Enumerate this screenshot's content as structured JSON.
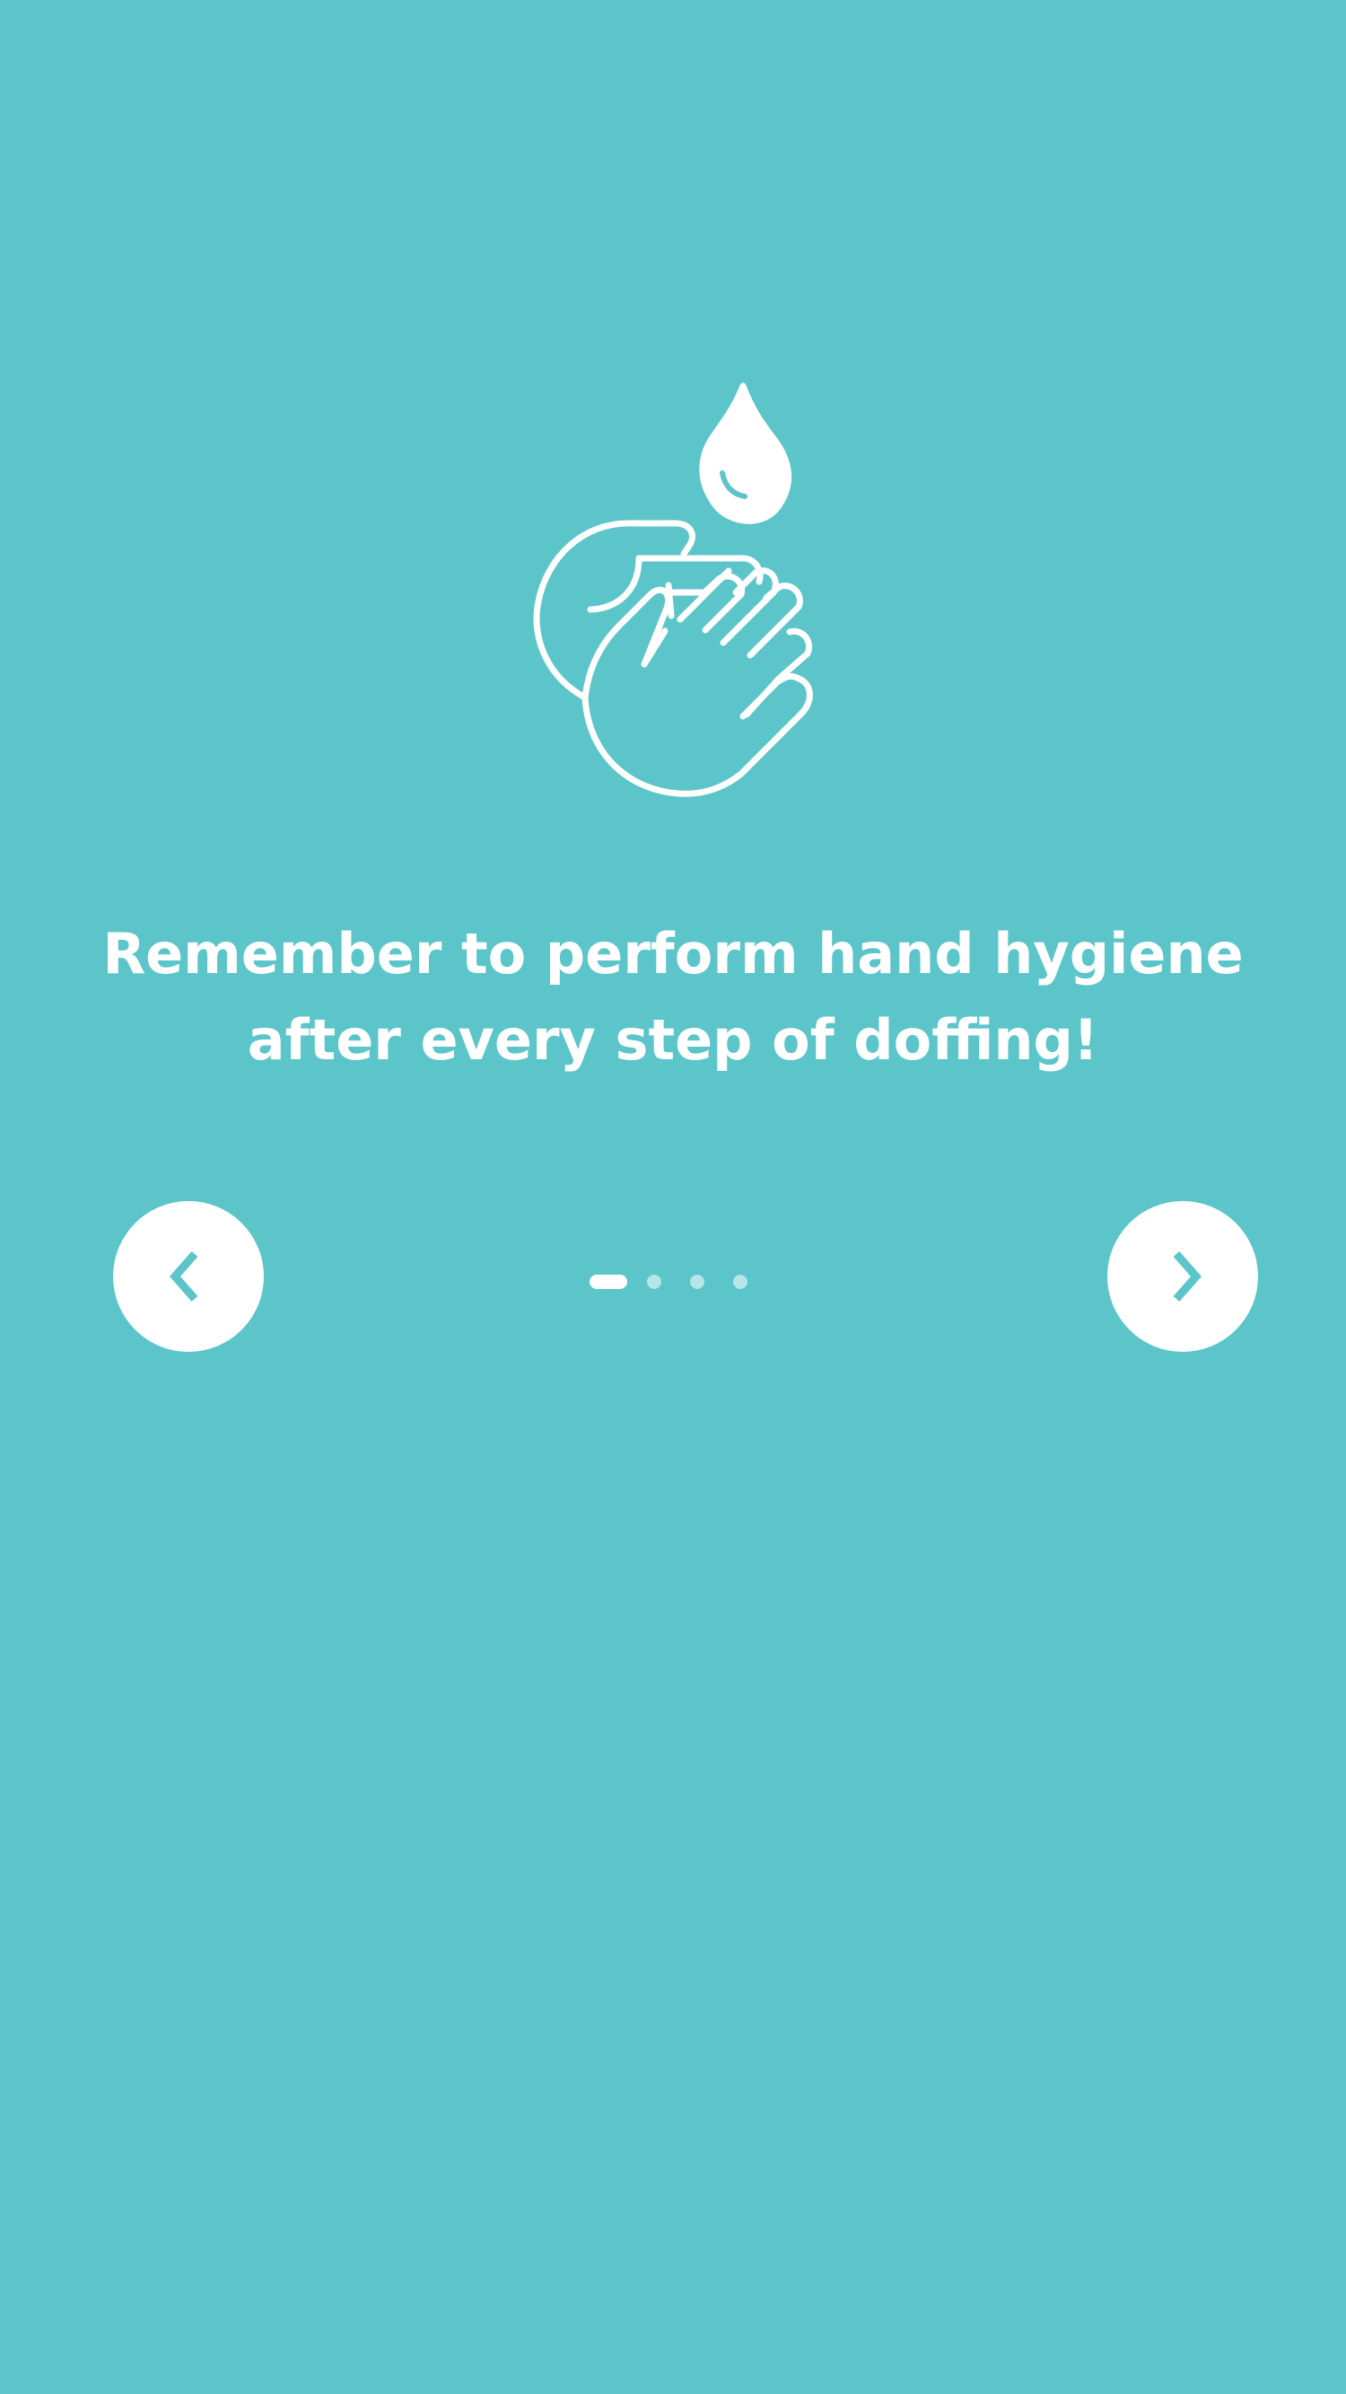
{
  "colors": {
    "background": "#5BC5CA",
    "foreground": "#FFFFFF",
    "accent": "#5BC5CA"
  },
  "message": {
    "line1": "Remember to perform hand hygiene",
    "line2": "after every step of doffing!"
  },
  "icons": {
    "hero": "hand-washing-icon",
    "prev": "chevron-left-icon",
    "next": "chevron-right-icon"
  },
  "pager": {
    "total_pages": 4,
    "current_page": 1
  }
}
